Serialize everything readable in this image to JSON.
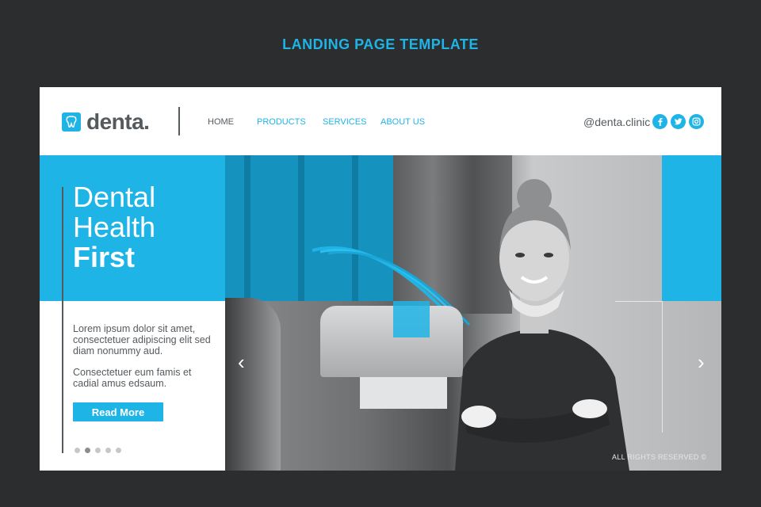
{
  "template_title": "LANDING PAGE TEMPLATE",
  "brand": {
    "name": "denta.",
    "icon": "tooth-icon"
  },
  "nav": [
    {
      "label": "HOME"
    },
    {
      "label": "PRODUCTS"
    },
    {
      "label": "SERVICES"
    },
    {
      "label": "ABOUT US"
    }
  ],
  "social": {
    "handle": "@denta.clinic",
    "icons": [
      "facebook-icon",
      "twitter-icon",
      "instagram-icon"
    ]
  },
  "hero": {
    "title_line1": "Dental",
    "title_line2": "Health",
    "title_line3": "First",
    "paragraph1": "Lorem ipsum dolor sit amet, consectetuer  adipiscing elit sed diam nonummy aud.",
    "paragraph2": "Consectetuer eum famis et cadial amus edsaum.",
    "button_label": "Read More"
  },
  "slider": {
    "prev_icon": "‹",
    "next_icon": "›",
    "dot_count": 5,
    "active_dot": 2
  },
  "footer_note": "ALL RIGHTS RESERVED ©",
  "colors": {
    "accent": "#1fb4e6",
    "text": "#555a5e",
    "background": "#2b2d2f"
  }
}
